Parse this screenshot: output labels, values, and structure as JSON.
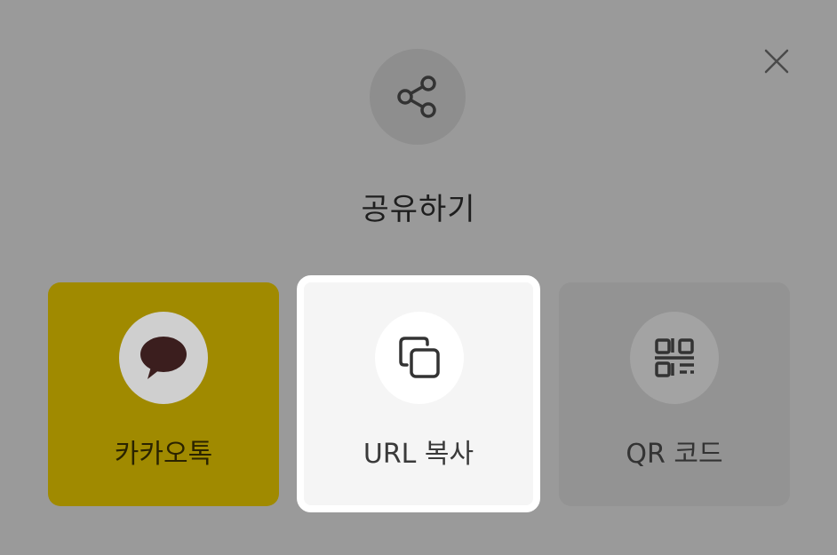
{
  "dialog": {
    "title": "공유하기",
    "close_icon": "close-icon",
    "header_icon": "share-icon"
  },
  "options": [
    {
      "id": "kakao",
      "label": "카카오톡",
      "icon": "speech-bubble-icon",
      "color": "#a08a00"
    },
    {
      "id": "url",
      "label": "URL 복사",
      "icon": "copy-icon",
      "color": "#f5f5f5",
      "selected": true
    },
    {
      "id": "qr",
      "label": "QR 코드",
      "icon": "qr-code-icon",
      "color": "#939393"
    }
  ]
}
